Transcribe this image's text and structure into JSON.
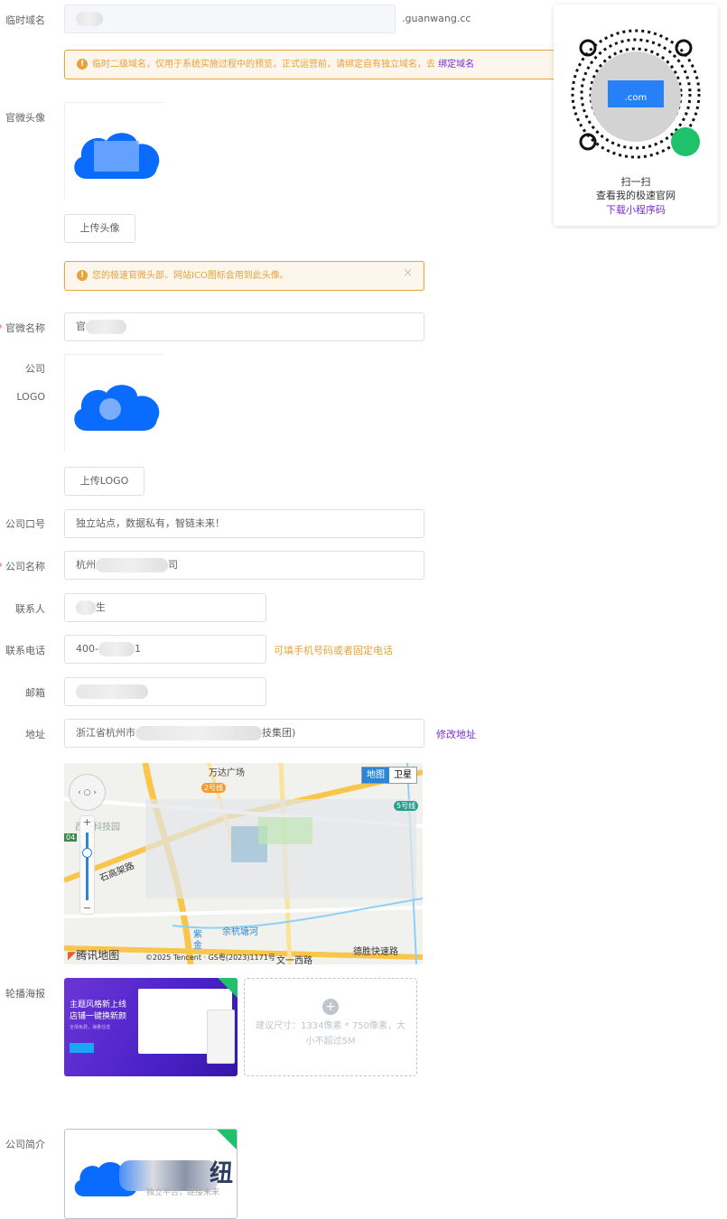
{
  "domain": {
    "label": "临时域名",
    "suffix": ".guanwang.cc"
  },
  "alert1": {
    "text": "临时二级域名，仅用于系统实施过程中的预览，正式运营前，请绑定自有独立域名，去 ",
    "link": "绑定域名"
  },
  "avatar": {
    "label": "官微头像",
    "upload": "上传头像"
  },
  "alert2": {
    "text": "您的极速官微头部、网站ICO图标会用到此头像。",
    "close": "×"
  },
  "wechat_name": {
    "label": "官微名称",
    "value": "官"
  },
  "logo": {
    "label1": "公司",
    "label2": "LOGO",
    "upload": "上传LOGO"
  },
  "slogan": {
    "label": "公司口号",
    "value": "独立站点，数据私有，智链未来！"
  },
  "company": {
    "label": "公司名称",
    "value_start": "杭州",
    "value_end": "司"
  },
  "contact": {
    "label": "联系人",
    "value": "生"
  },
  "phone": {
    "label": "联系电话",
    "value_start": "400-",
    "value_end": "1",
    "hint": "可填手机号码或者固定电话"
  },
  "email": {
    "label": "邮箱"
  },
  "address": {
    "label": "地址",
    "value_start": "浙江省杭州市",
    "value_end": "技集团)",
    "edit": "修改地址"
  },
  "map": {
    "mode_map": "地图",
    "mode_satellite": "卫星",
    "brand": "腾讯地图",
    "copyright": "©2025 Tencent · GS粤(2023)1171号",
    "places": [
      "万达广场",
      "2号线",
      "5号线",
      "西溪科技园",
      "石高架路",
      "余杭塘河",
      "紫金",
      "文一西路",
      "德胜快速路",
      "04"
    ]
  },
  "banner": {
    "label": "轮播海报",
    "poster_title1": "主题风格新上线",
    "poster_title2": "店铺一键换新颜",
    "poster_sub": "全场免费，海量任选",
    "upload_hint": "建议尺寸：1334像素 * 750像素，大小不超过5M"
  },
  "intro": {
    "label": "公司简介",
    "img_text": "纽",
    "img_sub": "独立平台，链接未来"
  },
  "qr": {
    "line1": "扫一扫",
    "line2": "查看我的极速官网",
    "link": "下载小程序码",
    "logo_text": ".com"
  },
  "colors": {
    "warning": "#e6a23c",
    "link": "#7b2fd1",
    "primary": "#0a6cff",
    "success": "#1fc16b"
  }
}
